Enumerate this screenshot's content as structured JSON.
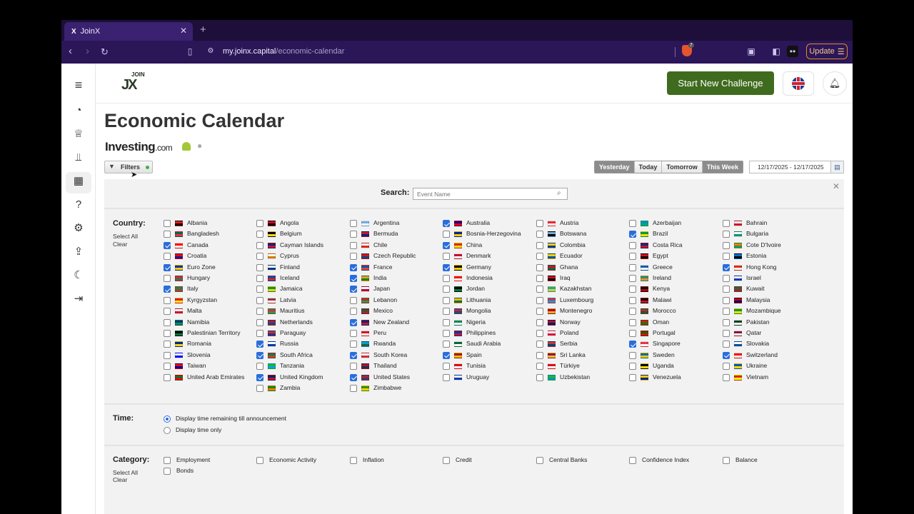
{
  "browser": {
    "tab_title": "JoinX",
    "favicon": "X",
    "url_host": "my.joinx.capital",
    "url_path": "/economic-calendar",
    "brave_count": "7",
    "update_label": "Update"
  },
  "header": {
    "logo_top": "JOIN",
    "logo_main": "JX",
    "start_challenge": "Start New Challenge"
  },
  "main": {
    "title": "Economic Calendar",
    "provider_name": "Investing",
    "provider_suffix": ".com"
  },
  "filters": {
    "button_label": "Filters",
    "ranges": [
      "Yesterday",
      "Today",
      "Tomorrow",
      "This Week"
    ],
    "date_range": "12/17/2025 - 12/17/2025",
    "search_label": "Search:",
    "search_placeholder": "Event Name",
    "country_label": "Country:",
    "select_all": "Select All",
    "clear": "Clear",
    "time_label": "Time:",
    "time_options": [
      "Display time remaining till announcement",
      "Display time only"
    ],
    "time_selected": 0,
    "category_label": "Category:",
    "categories": [
      "Employment",
      "Economic Activity",
      "Inflation",
      "Credit",
      "Central Banks",
      "Confidence Index",
      "Balance",
      "Bonds"
    ]
  },
  "countries": [
    [
      {
        "name": "Albania",
        "checked": false,
        "flag": [
          "#e41e20",
          "#000000"
        ]
      },
      {
        "name": "Bangladesh",
        "checked": false,
        "flag": [
          "#006a4e",
          "#f42a41"
        ]
      },
      {
        "name": "Canada",
        "checked": true,
        "flag": [
          "#ff0000",
          "#ffffff"
        ]
      },
      {
        "name": "Croatia",
        "checked": false,
        "flag": [
          "#ff0000",
          "#171796"
        ]
      },
      {
        "name": "Euro Zone",
        "checked": true,
        "flag": [
          "#003399",
          "#ffcc00"
        ]
      },
      {
        "name": "Hungary",
        "checked": false,
        "flag": [
          "#cd2a3e",
          "#436f4d"
        ]
      },
      {
        "name": "Italy",
        "checked": true,
        "flag": [
          "#009246",
          "#ce2b37"
        ]
      },
      {
        "name": "Kyrgyzstan",
        "checked": false,
        "flag": [
          "#e8112d",
          "#ffef00"
        ]
      },
      {
        "name": "Malta",
        "checked": false,
        "flag": [
          "#ffffff",
          "#cf142b"
        ]
      },
      {
        "name": "Namibia",
        "checked": false,
        "flag": [
          "#003580",
          "#009543"
        ]
      },
      {
        "name": "Palestinian Territory",
        "checked": false,
        "flag": [
          "#000000",
          "#007a3d"
        ]
      },
      {
        "name": "Romania",
        "checked": false,
        "flag": [
          "#002b7f",
          "#fcd116"
        ]
      },
      {
        "name": "Slovenia",
        "checked": false,
        "flag": [
          "#ffffff",
          "#0000ff"
        ]
      },
      {
        "name": "Taiwan",
        "checked": false,
        "flag": [
          "#fe0000",
          "#000095"
        ]
      },
      {
        "name": "United Arab Emirates",
        "checked": false,
        "flag": [
          "#00732f",
          "#ff0000"
        ]
      }
    ],
    [
      {
        "name": "Angola",
        "checked": false,
        "flag": [
          "#cc092f",
          "#000000"
        ]
      },
      {
        "name": "Belgium",
        "checked": false,
        "flag": [
          "#000000",
          "#fdda24"
        ]
      },
      {
        "name": "Cayman Islands",
        "checked": false,
        "flag": [
          "#00247d",
          "#cf142b"
        ]
      },
      {
        "name": "Cyprus",
        "checked": false,
        "flag": [
          "#ffffff",
          "#d57800"
        ]
      },
      {
        "name": "Finland",
        "checked": false,
        "flag": [
          "#ffffff",
          "#003580"
        ]
      },
      {
        "name": "Iceland",
        "checked": false,
        "flag": [
          "#02529c",
          "#dc1e35"
        ]
      },
      {
        "name": "Jamaica",
        "checked": false,
        "flag": [
          "#009b3a",
          "#fed100"
        ]
      },
      {
        "name": "Latvia",
        "checked": false,
        "flag": [
          "#9e3039",
          "#ffffff"
        ]
      },
      {
        "name": "Mauritius",
        "checked": false,
        "flag": [
          "#ea2839",
          "#00a551"
        ]
      },
      {
        "name": "Netherlands",
        "checked": false,
        "flag": [
          "#ae1c28",
          "#21468b"
        ]
      },
      {
        "name": "Paraguay",
        "checked": false,
        "flag": [
          "#d52b1e",
          "#0038a8"
        ]
      },
      {
        "name": "Russia",
        "checked": true,
        "flag": [
          "#ffffff",
          "#0039a6"
        ]
      },
      {
        "name": "South Africa",
        "checked": true,
        "flag": [
          "#007a4d",
          "#de3831"
        ]
      },
      {
        "name": "Tanzania",
        "checked": false,
        "flag": [
          "#1eb53a",
          "#00a3dd"
        ]
      },
      {
        "name": "United Kingdom",
        "checked": true,
        "flag": [
          "#012169",
          "#c8102e"
        ]
      },
      {
        "name": "Zambia",
        "checked": false,
        "flag": [
          "#198a00",
          "#ef7d00"
        ]
      }
    ],
    [
      {
        "name": "Argentina",
        "checked": false,
        "flag": [
          "#74acdf",
          "#ffffff"
        ]
      },
      {
        "name": "Bermuda",
        "checked": false,
        "flag": [
          "#cf142b",
          "#00247d"
        ]
      },
      {
        "name": "Chile",
        "checked": false,
        "flag": [
          "#ffffff",
          "#d52b1e"
        ]
      },
      {
        "name": "Czech Republic",
        "checked": false,
        "flag": [
          "#d7141a",
          "#11457e"
        ]
      },
      {
        "name": "France",
        "checked": true,
        "flag": [
          "#0055a4",
          "#ef4135"
        ]
      },
      {
        "name": "India",
        "checked": true,
        "flag": [
          "#ff9933",
          "#138808"
        ]
      },
      {
        "name": "Japan",
        "checked": true,
        "flag": [
          "#ffffff",
          "#bc002d"
        ]
      },
      {
        "name": "Lebanon",
        "checked": false,
        "flag": [
          "#ee161f",
          "#00a850"
        ]
      },
      {
        "name": "Mexico",
        "checked": false,
        "flag": [
          "#006847",
          "#ce1126"
        ]
      },
      {
        "name": "New Zealand",
        "checked": true,
        "flag": [
          "#00247d",
          "#cc142b"
        ]
      },
      {
        "name": "Peru",
        "checked": false,
        "flag": [
          "#d91023",
          "#ffffff"
        ]
      },
      {
        "name": "Rwanda",
        "checked": false,
        "flag": [
          "#00a1de",
          "#20603d"
        ]
      },
      {
        "name": "South Korea",
        "checked": true,
        "flag": [
          "#ffffff",
          "#cd2e3a"
        ]
      },
      {
        "name": "Thailand",
        "checked": false,
        "flag": [
          "#a51931",
          "#2d2a4a"
        ]
      },
      {
        "name": "United States",
        "checked": true,
        "flag": [
          "#b22234",
          "#3c3b6e"
        ]
      },
      {
        "name": "Zimbabwe",
        "checked": false,
        "flag": [
          "#319208",
          "#ffd200"
        ]
      }
    ],
    [
      {
        "name": "Australia",
        "checked": true,
        "flag": [
          "#00008b",
          "#ff0000"
        ]
      },
      {
        "name": "Bosnia-Herzegovina",
        "checked": false,
        "flag": [
          "#002395",
          "#fecb00"
        ]
      },
      {
        "name": "China",
        "checked": true,
        "flag": [
          "#de2910",
          "#ffde00"
        ]
      },
      {
        "name": "Denmark",
        "checked": false,
        "flag": [
          "#c60c30",
          "#ffffff"
        ]
      },
      {
        "name": "Germany",
        "checked": true,
        "flag": [
          "#000000",
          "#ffce00"
        ]
      },
      {
        "name": "Indonesia",
        "checked": false,
        "flag": [
          "#ff0000",
          "#ffffff"
        ]
      },
      {
        "name": "Jordan",
        "checked": false,
        "flag": [
          "#000000",
          "#007a3d"
        ]
      },
      {
        "name": "Lithuania",
        "checked": false,
        "flag": [
          "#fdb913",
          "#006a44"
        ]
      },
      {
        "name": "Mongolia",
        "checked": false,
        "flag": [
          "#c4272f",
          "#015197"
        ]
      },
      {
        "name": "Nigeria",
        "checked": false,
        "flag": [
          "#008751",
          "#ffffff"
        ]
      },
      {
        "name": "Philippines",
        "checked": false,
        "flag": [
          "#0038a8",
          "#ce1126"
        ]
      },
      {
        "name": "Saudi Arabia",
        "checked": false,
        "flag": [
          "#006c35",
          "#ffffff"
        ]
      },
      {
        "name": "Spain",
        "checked": true,
        "flag": [
          "#aa151b",
          "#f1bf00"
        ]
      },
      {
        "name": "Tunisia",
        "checked": false,
        "flag": [
          "#e70013",
          "#ffffff"
        ]
      },
      {
        "name": "Uruguay",
        "checked": false,
        "flag": [
          "#ffffff",
          "#0038a8"
        ]
      }
    ],
    [
      {
        "name": "Austria",
        "checked": false,
        "flag": [
          "#ed2939",
          "#ffffff"
        ]
      },
      {
        "name": "Botswana",
        "checked": false,
        "flag": [
          "#75aadb",
          "#000000"
        ]
      },
      {
        "name": "Colombia",
        "checked": false,
        "flag": [
          "#fcd116",
          "#003893"
        ]
      },
      {
        "name": "Ecuador",
        "checked": false,
        "flag": [
          "#ffd100",
          "#034ea2"
        ]
      },
      {
        "name": "Ghana",
        "checked": false,
        "flag": [
          "#ce1126",
          "#006b3f"
        ]
      },
      {
        "name": "Iraq",
        "checked": false,
        "flag": [
          "#ce1126",
          "#000000"
        ]
      },
      {
        "name": "Kazakhstan",
        "checked": false,
        "flag": [
          "#00afca",
          "#fec50c"
        ]
      },
      {
        "name": "Luxembourg",
        "checked": false,
        "flag": [
          "#ed2939",
          "#00a1de"
        ]
      },
      {
        "name": "Montenegro",
        "checked": false,
        "flag": [
          "#c40308",
          "#d4af3a"
        ]
      },
      {
        "name": "Norway",
        "checked": false,
        "flag": [
          "#ba0c2f",
          "#00205b"
        ]
      },
      {
        "name": "Poland",
        "checked": false,
        "flag": [
          "#ffffff",
          "#dc143c"
        ]
      },
      {
        "name": "Serbia",
        "checked": false,
        "flag": [
          "#c6363c",
          "#0c4076"
        ]
      },
      {
        "name": "Sri Lanka",
        "checked": false,
        "flag": [
          "#8d153a",
          "#ffbe29"
        ]
      },
      {
        "name": "Türkiye",
        "checked": false,
        "flag": [
          "#e30a17",
          "#ffffff"
        ]
      },
      {
        "name": "Uzbekistan",
        "checked": false,
        "flag": [
          "#1eb53a",
          "#0099b5"
        ]
      }
    ],
    [
      {
        "name": "Azerbaijan",
        "checked": false,
        "flag": [
          "#0092bc",
          "#00af66"
        ]
      },
      {
        "name": "Brazil",
        "checked": true,
        "flag": [
          "#009c3b",
          "#ffdf00"
        ]
      },
      {
        "name": "Costa Rica",
        "checked": false,
        "flag": [
          "#002b7f",
          "#ce1126"
        ]
      },
      {
        "name": "Egypt",
        "checked": false,
        "flag": [
          "#ce1126",
          "#000000"
        ]
      },
      {
        "name": "Greece",
        "checked": false,
        "flag": [
          "#0d5eaf",
          "#ffffff"
        ]
      },
      {
        "name": "Ireland",
        "checked": false,
        "flag": [
          "#169b62",
          "#ff883e"
        ]
      },
      {
        "name": "Kenya",
        "checked": false,
        "flag": [
          "#000000",
          "#bb0000"
        ]
      },
      {
        "name": "Malawi",
        "checked": false,
        "flag": [
          "#000000",
          "#ce1126"
        ]
      },
      {
        "name": "Morocco",
        "checked": false,
        "flag": [
          "#c1272d",
          "#006233"
        ]
      },
      {
        "name": "Oman",
        "checked": false,
        "flag": [
          "#db161b",
          "#008000"
        ]
      },
      {
        "name": "Portugal",
        "checked": false,
        "flag": [
          "#006600",
          "#ff0000"
        ]
      },
      {
        "name": "Singapore",
        "checked": true,
        "flag": [
          "#ef3340",
          "#ffffff"
        ]
      },
      {
        "name": "Sweden",
        "checked": false,
        "flag": [
          "#006aa7",
          "#fecc00"
        ]
      },
      {
        "name": "Uganda",
        "checked": false,
        "flag": [
          "#000000",
          "#fcdc04"
        ]
      },
      {
        "name": "Venezuela",
        "checked": false,
        "flag": [
          "#ffcc00",
          "#00247d"
        ]
      }
    ],
    [
      {
        "name": "Bahrain",
        "checked": false,
        "flag": [
          "#ffffff",
          "#ce1126"
        ]
      },
      {
        "name": "Bulgaria",
        "checked": false,
        "flag": [
          "#ffffff",
          "#00966e"
        ]
      },
      {
        "name": "Cote D'Ivoire",
        "checked": false,
        "flag": [
          "#f77f00",
          "#009e60"
        ]
      },
      {
        "name": "Estonia",
        "checked": false,
        "flag": [
          "#0072ce",
          "#000000"
        ]
      },
      {
        "name": "Hong Kong",
        "checked": true,
        "flag": [
          "#de2910",
          "#ffffff"
        ]
      },
      {
        "name": "Israel",
        "checked": false,
        "flag": [
          "#ffffff",
          "#0038b8"
        ]
      },
      {
        "name": "Kuwait",
        "checked": false,
        "flag": [
          "#007a3d",
          "#ce1126"
        ]
      },
      {
        "name": "Malaysia",
        "checked": false,
        "flag": [
          "#cc0001",
          "#010066"
        ]
      },
      {
        "name": "Mozambique",
        "checked": false,
        "flag": [
          "#009a44",
          "#fce100"
        ]
      },
      {
        "name": "Pakistan",
        "checked": false,
        "flag": [
          "#01411c",
          "#ffffff"
        ]
      },
      {
        "name": "Qatar",
        "checked": false,
        "flag": [
          "#8a1538",
          "#ffffff"
        ]
      },
      {
        "name": "Slovakia",
        "checked": false,
        "flag": [
          "#ffffff",
          "#0b4ea2"
        ]
      },
      {
        "name": "Switzerland",
        "checked": true,
        "flag": [
          "#ff0000",
          "#ffffff"
        ]
      },
      {
        "name": "Ukraine",
        "checked": false,
        "flag": [
          "#0057b7",
          "#ffd700"
        ]
      },
      {
        "name": "Vietnam",
        "checked": false,
        "flag": [
          "#da251d",
          "#ffff00"
        ]
      }
    ]
  ]
}
